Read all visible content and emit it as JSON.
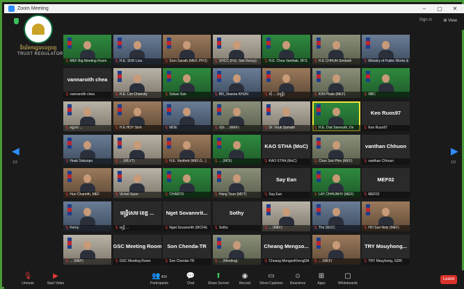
{
  "window": {
    "title": "Zoom Meeting",
    "controls": [
      "–",
      "▢",
      "✕"
    ]
  },
  "topbar": {
    "sign_in": "Sign in",
    "view": "View"
  },
  "logo": {
    "khmer": "និយ័តករដ្ឋបាលទ្រព្យ",
    "english": "TRUST REGULATOR"
  },
  "pagination": {
    "left": "1/3",
    "right": "1/3"
  },
  "tiles": [
    {
      "caption": "MEF Big Meeting Room",
      "style": "video v4"
    },
    {
      "caption": "H.E. SOK Liza",
      "style": "video v2"
    },
    {
      "caption": "Srun Sarath (MEF, PFO)",
      "style": "video v3"
    },
    {
      "caption": "SHCC (H.E. Sok Kenzy)",
      "style": "video v5"
    },
    {
      "caption": "H.E. Chea Vanthak, RFS",
      "style": "video v4"
    },
    {
      "caption": "H.E.CHHUN Simbath",
      "style": "video v1"
    },
    {
      "caption": "Ministry of Public Works &",
      "style": "video v2"
    },
    {
      "caption": "vannaroith chea",
      "big": "vannaroith chea",
      "style": "name"
    },
    {
      "caption": "H.E. Lim Chanvity",
      "style": "video v5"
    },
    {
      "caption": "Sokan San",
      "style": "video v4"
    },
    {
      "caption": "BR_Veasna KHUN",
      "style": "video v2"
    },
    {
      "caption": "ស៊ី ... (មន្ត្រី)",
      "style": "video v3"
    },
    {
      "caption": "KIM Phala (MEF)",
      "style": "video v1"
    },
    {
      "caption": "NBC",
      "style": "video v4"
    },
    {
      "caption": "អង្គការ ...",
      "style": "video v5"
    },
    {
      "caption": "H.E.HOY Sinh",
      "style": "video v3"
    },
    {
      "caption": "MOE",
      "style": "video v2"
    },
    {
      "caption": "ស៊ុង ... (MEF)",
      "style": "video v1"
    },
    {
      "caption": "Dr. Vouk Samath",
      "style": "video v5"
    },
    {
      "caption": "H.E. Duk Sarevuth, De",
      "style": "video v4",
      "speaking": true
    },
    {
      "caption": "Keo Ruos97",
      "big": "Keo Ruos97",
      "style": "name"
    },
    {
      "caption": "Heak Sokunpo",
      "style": "video v2"
    },
    {
      "caption": "... (MLVT)",
      "style": "video v5"
    },
    {
      "caption": "H.E. Vantheit (MEF,G...)",
      "style": "video v3"
    },
    {
      "caption": "... (MOI)",
      "style": "video v4"
    },
    {
      "caption": "KAO STHA (MoC)",
      "big": "KAO STHA (MoC)",
      "style": "name"
    },
    {
      "caption": "Chan Sok Phin (MEF)",
      "style": "video v1"
    },
    {
      "caption": "vanthan Chhuon",
      "big": "vanthan Chhuon",
      "style": "name"
    },
    {
      "caption": "Hun Chanrith, MEF",
      "style": "video v3"
    },
    {
      "caption": "Vichet Suon",
      "style": "video v5"
    },
    {
      "caption": "CHANTO",
      "style": "video v4"
    },
    {
      "caption": "Hang Toun (MDT)",
      "style": "video v1"
    },
    {
      "caption": "Say Ean",
      "big": "Say Ean",
      "style": "name"
    },
    {
      "caption": "LAY CHHUNHY (MEF)",
      "style": "video v4"
    },
    {
      "caption": "MEF02",
      "big": "MEF02",
      "style": "name"
    },
    {
      "caption": "Kerny",
      "style": "video v2"
    },
    {
      "caption": "មន្ត្រី ...",
      "big": "មន្ត្រីសេម ខេត្ត ...",
      "style": "name"
    },
    {
      "caption": "Nget Sovannrith (MCFA)",
      "big": "Nget Sovannrit...",
      "style": "name"
    },
    {
      "caption": "Sothy",
      "big": "Sothy",
      "style": "name"
    },
    {
      "caption": "... (MEF)",
      "style": "video v5"
    },
    {
      "caption": "The SECC",
      "style": "video v2"
    },
    {
      "caption": "HO Sun Nely (MEF)",
      "style": "video v3"
    },
    {
      "caption": "... (MEF)",
      "style": "video v5"
    },
    {
      "caption": "GSC Meeting Room",
      "big": "GSC Meeting Room",
      "style": "name"
    },
    {
      "caption": "Son Chenda-TR",
      "big": "Son Chenda-TR",
      "style": "name"
    },
    {
      "caption": "... (Meeting)",
      "style": "video v1"
    },
    {
      "caption": "Cheang MengsoKhengDA",
      "big": "Cheang Mengso...",
      "style": "name"
    },
    {
      "caption": "... (MEF)",
      "style": "video v3"
    },
    {
      "caption": "TRY Mouyhong, GDR",
      "big": "TRY Mouyhong...",
      "style": "name"
    }
  ],
  "toolbar": {
    "unmute": "Unmute",
    "start_video": "Start Video",
    "participants": "Participants",
    "participants_count": "409",
    "chat": "Chat",
    "share_screen": "Share Screen",
    "record": "Record",
    "show_captions": "Show Captions",
    "reactions": "Reactions",
    "apps": "Apps",
    "whiteboards": "Whiteboards",
    "leave": "Leave"
  },
  "colors": {
    "accent": "#2d8cff",
    "border": "#4a9a3a",
    "leave": "#d9322b",
    "speaking": "#f0e63a"
  }
}
